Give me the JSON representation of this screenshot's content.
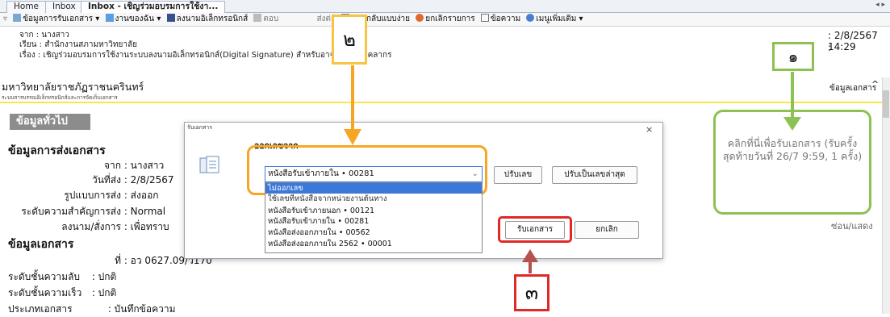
{
  "tabs": [
    {
      "label": "Home"
    },
    {
      "label": "Inbox"
    },
    {
      "label": "Inbox - เชิญร่วมอบรมการใช้งา..."
    }
  ],
  "tab_scroll": "◂ ▸",
  "toolbar": {
    "items": [
      "ข้อมูลการรับเอกสาร ▾",
      "งานของฉัน ▾",
      "ลงนามอิเล็กทรอนิกส์",
      "ตอบ",
      "ส่งต่อ",
      "ตอบกลับแบบง่าย",
      "ยกเลิกรายการ",
      "ข้อความ",
      "เมนูเพิ่มเติม ▾"
    ]
  },
  "header": {
    "from": "จาก : นางสาว",
    "to": "เรียน : สำนักงานสภามหาวิทยาลัย",
    "subject": "เรื่อง : เชิญร่วมอบรมการใช้งานระบบลงนามอิเล็กทรอนิกส์(Digital Signature) สำหรับอาจารย์และบุคลากร",
    "date": ": 2/8/2567 14:29",
    "date2": ": -"
  },
  "doc": {
    "title": "มหาวิทยาลัยราชภัฏราชนครินทร์",
    "subtitle": "ระบบสารบรรณอิเล็กทรอนิกส์และการจัดเก็บเอกสาร",
    "info_label": "ข้อมูลเอกสาร",
    "general_tab": "ข้อมูลทั่วไป",
    "send_section": "ข้อมูลการส่งเอกสาร",
    "rows": [
      {
        "label": "จาก",
        "value": "นางสาว"
      },
      {
        "label": "วันที่ส่ง",
        "value": "2/8/2567"
      },
      {
        "label": "รูปแบบการส่ง",
        "value": "ส่งออก"
      },
      {
        "label": "ระดับความสำคัญการส่ง",
        "value": "Normal"
      },
      {
        "label": "ลงนาม/สั่งการ",
        "value": "เพื่อทราบ"
      }
    ],
    "doc_section": "ข้อมูลเอกสาร",
    "doc_rows": [
      {
        "label": "ที่",
        "value": "อว 0627.09/ว170"
      },
      {
        "label": "ระดับชั้นความลับ",
        "value": "ปกติ"
      },
      {
        "label": "ระดับชั้นความเร็ว",
        "value": "ปกติ"
      },
      {
        "label": "ประเภทเอกสาร",
        "value": "บันทึกข้อความ"
      }
    ]
  },
  "receive_panel": {
    "text": "คลิกที่นี่เพื่อรับเอกสาร (รับครั้งสุดท้ายวันที่ 26/7 9:59, 1 ครั้ง)",
    "toggle": "ซ่อน/แสดง"
  },
  "dialog": {
    "title": "รับเอกสาร",
    "close": "×",
    "issue_label": "ออกเลขจาก",
    "selected": "หนังสือรับเข้าภายใน • 00281",
    "options": [
      "ไม่ออกเลข",
      "ใช้เลขที่หนังสือจากหน่วยงานต้นทาง",
      "หนังสือรับเข้าภายนอก • 00121",
      "หนังสือรับเข้าภายใน • 00281",
      "หนังสือส่งออกภายใน • 00562",
      "หนังสือส่งออกภายใน 2562 • 00001"
    ],
    "btn_adjust": "ปรับเลข",
    "btn_latest": "ปรับเป็นเลขล่าสุด",
    "btn_receive": "รับเอกสาร",
    "btn_cancel": "ยกเลิก"
  },
  "annotations": {
    "one": "๑",
    "two": "๒",
    "three": "๓"
  },
  "colors": {
    "orange": "#f6a623",
    "green": "#8dc152",
    "red": "#e02828",
    "darkred": "#b5524e",
    "select_blue": "#3b78d8"
  }
}
